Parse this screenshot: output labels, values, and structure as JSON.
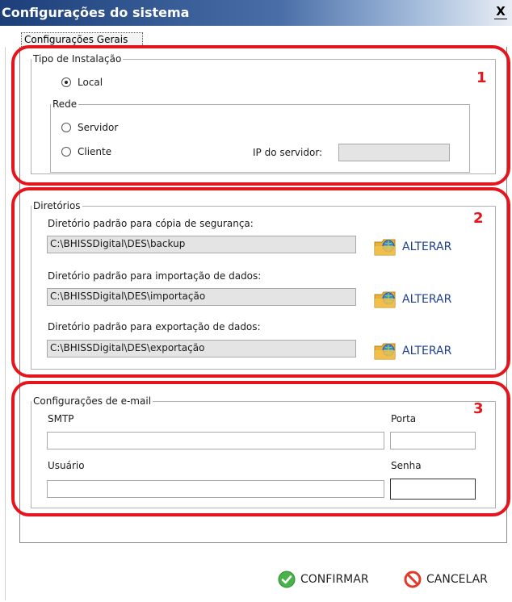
{
  "window": {
    "title": "Configurações do sistema",
    "close_label": "X"
  },
  "tab": {
    "label": "Configurações Gerais"
  },
  "install": {
    "legend": "Tipo de Instalação",
    "local_label": "Local",
    "network_legend": "Rede",
    "server_label": "Servidor",
    "client_label": "Cliente",
    "ip_label": "IP do servidor:",
    "ip_value": "",
    "selected": "local"
  },
  "directories": {
    "legend": "Diretórios",
    "items": [
      {
        "label": "Diretório padrão para cópia de segurança:",
        "path": "C:\\BHISSDigital\\DES\\backup",
        "button": "ALTERAR"
      },
      {
        "label": "Diretório padrão para importação de dados:",
        "path": "C:\\BHISSDigital\\DES\\importação",
        "button": "ALTERAR"
      },
      {
        "label": "Diretório padrão para exportação de dados:",
        "path": "C:\\BHISSDigital\\DES\\exportação",
        "button": "ALTERAR"
      }
    ]
  },
  "email": {
    "legend": "Configurações de e-mail",
    "smtp_label": "SMTP",
    "smtp_value": "",
    "port_label": "Porta",
    "port_value": "",
    "user_label": "Usuário",
    "user_value": "",
    "password_label": "Senha",
    "password_value": ""
  },
  "annotations": {
    "n1": "1",
    "n2": "2",
    "n3": "3",
    "color": "#e4151d"
  },
  "actions": {
    "confirm_label": "CONFIRMAR",
    "cancel_label": "CANCELAR"
  },
  "icons": {
    "close": "close-icon",
    "folder": "folder-globe-icon",
    "confirm": "check-circle-icon",
    "cancel": "forbidden-circle-icon"
  }
}
